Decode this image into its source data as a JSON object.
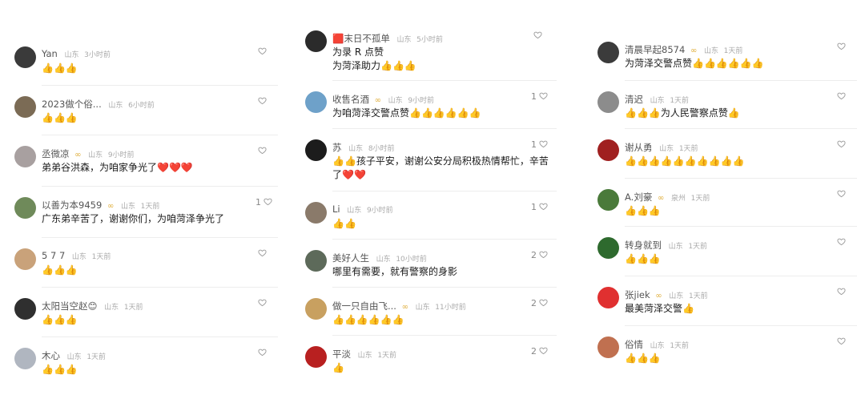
{
  "col1": [
    {
      "name": "Yan",
      "region": "山东",
      "time": "3小时前",
      "text": "👍👍👍",
      "likes": ""
    },
    {
      "name": "2023做个俗...",
      "region": "山东",
      "time": "6小时前",
      "text": "👍👍👍",
      "likes": ""
    },
    {
      "name": "丞微凉",
      "badge": "∞",
      "region": "山东",
      "time": "9小时前",
      "text": "弟弟谷洪森，为咱家争光了❤️❤️❤️",
      "likes": ""
    },
    {
      "name": "以善为本9459",
      "badge": "∞",
      "region": "山东",
      "time": "1天前",
      "text": "广东弟辛苦了，谢谢你们，为咱菏泽争光了",
      "likes": "1"
    },
    {
      "name": "5   7   7",
      "region": "山东",
      "time": "1天前",
      "text": "👍👍👍",
      "likes": ""
    },
    {
      "name": "太阳当空赵😊",
      "region": "山东",
      "time": "1天前",
      "text": "👍👍👍",
      "likes": ""
    },
    {
      "name": "木心",
      "region": "山东",
      "time": "1天前",
      "text": "👍👍👍",
      "likes": ""
    }
  ],
  "col2": [
    {
      "name": "🟥末日不孤单",
      "region": "山东",
      "time": "5小时前",
      "text": "为录 R 点赞",
      "text2": "为菏泽助力👍👍👍",
      "likes": ""
    },
    {
      "name": "收售名酒",
      "badge": "∞",
      "region": "山东",
      "time": "9小时前",
      "text": "为咱菏泽交警点赞👍👍👍👍👍👍",
      "likes": "1"
    },
    {
      "name": "苏",
      "region": "山东",
      "time": "8小时前",
      "text": "👍👍孩子平安，谢谢公安分局积极热情帮忙，辛苦",
      "text2": "了❤️❤️",
      "likes": "1"
    },
    {
      "name": "Li",
      "region": "山东",
      "time": "9小时前",
      "text": "👍👍",
      "likes": "1"
    },
    {
      "name": "美好人生",
      "region": "山东",
      "time": "10小时前",
      "text": "哪里有需要，就有警察的身影",
      "likes": "2"
    },
    {
      "name": "做一只自由飞...",
      "badge": "∞",
      "region": "山东",
      "time": "11小时前",
      "text": "👍👍👍👍👍👍",
      "likes": "2"
    },
    {
      "name": "平淡",
      "region": "山东",
      "time": "1天前",
      "text": "👍",
      "likes": "2"
    }
  ],
  "col3": [
    {
      "name": "清晨早起8574",
      "badge": "∞",
      "region": "山东",
      "time": "1天前",
      "text": "为菏泽交警点赞👍👍👍👍👍👍",
      "likes": ""
    },
    {
      "name": "清迟",
      "region": "山东",
      "time": "1天前",
      "text": "👍👍👍为人民警察点赞👍",
      "likes": ""
    },
    {
      "name": "谢从勇",
      "region": "山东",
      "time": "1天前",
      "text": "👍👍👍👍👍👍👍👍👍👍",
      "likes": ""
    },
    {
      "name": "A.刘豪",
      "badge": "∞",
      "region": "泉州",
      "time": "1天前",
      "text": "👍👍👍",
      "likes": ""
    },
    {
      "name": "转身就到",
      "region": "山东",
      "time": "1天前",
      "text": "👍👍👍",
      "likes": ""
    },
    {
      "name": "张jiek",
      "badge": "∞",
      "region": "山东",
      "time": "1天前",
      "text": "最美菏泽交警👍",
      "likes": ""
    },
    {
      "name": "俗情",
      "region": "山东",
      "time": "1天前",
      "text": "👍👍👍",
      "likes": ""
    }
  ],
  "colors": {
    "accent": "#e0b040",
    "heart": "#999999",
    "divider": "#ededed"
  },
  "icons": {
    "like": "heart-icon",
    "badge": "infinity-badge-icon"
  }
}
